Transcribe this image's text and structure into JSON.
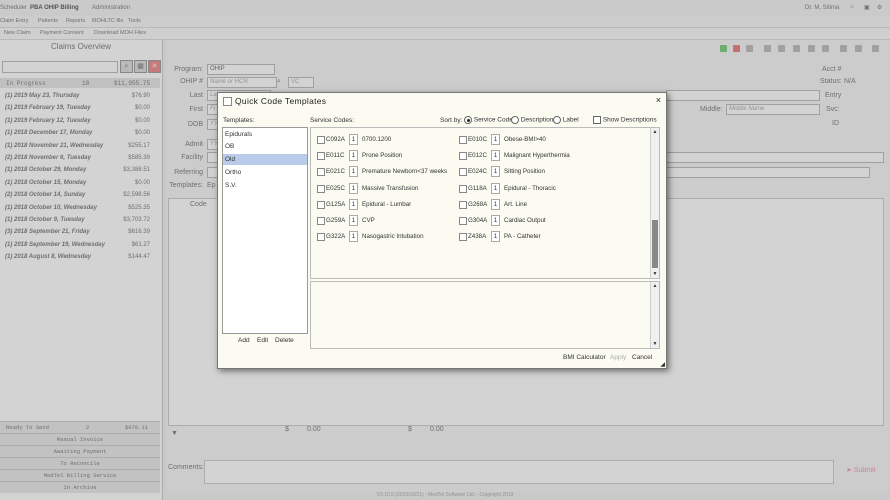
{
  "topbar": {
    "tabs": [
      "Scheduler",
      "PBA OHIP Billing",
      "Administration"
    ],
    "user": "Dr. M, Sitima"
  },
  "menubar": {
    "items": [
      "Claim Entry",
      "Patients",
      "Reports",
      "MOHLTC file",
      "Tools"
    ]
  },
  "subbar": {
    "items": [
      "New Claim",
      "Payment Consent",
      "Download MOH Files"
    ]
  },
  "left_panel": {
    "title": "Claims Overview",
    "in_progress": {
      "label": "In Progress",
      "count": "18",
      "amount": "$11,955.75"
    },
    "claims": [
      {
        "date": "(1) 2019 May 23, Thursday",
        "amount": "$76.90"
      },
      {
        "date": "(1) 2019 February 19, Tuesday",
        "amount": "$0.00"
      },
      {
        "date": "(1) 2019 February 12, Tuesday",
        "amount": "$0.00"
      },
      {
        "date": "(1) 2018 December 17, Monday",
        "amount": "$0.00"
      },
      {
        "date": "(1) 2018 November 21, Wednesday",
        "amount": "$255.17"
      },
      {
        "date": "(2) 2018 November 6, Tuesday",
        "amount": "$585.39"
      },
      {
        "date": "(1) 2018 October 29, Monday",
        "amount": "$3,388.51"
      },
      {
        "date": "(1) 2018 October 15, Monday",
        "amount": "$0.00"
      },
      {
        "date": "(2) 2018 October 14, Sunday",
        "amount": "$2,598.56"
      },
      {
        "date": "(1) 2018 October 10, Wednesday",
        "amount": "$525.35"
      },
      {
        "date": "(1) 2018 October 9, Tuesday",
        "amount": "$3,703.72"
      },
      {
        "date": "(3) 2018 September 21, Friday",
        "amount": "$616.39"
      },
      {
        "date": "(1) 2018 September 19, Wednesday",
        "amount": "$61.27"
      },
      {
        "date": "(1) 2018 August 8, Wednesday",
        "amount": "$144.47"
      }
    ],
    "ready_to_send": {
      "label": "Ready To Send",
      "count": "2",
      "amount": "$970.11"
    },
    "footer_items": [
      "Manual Invoice",
      "Awaiting Payment",
      "To Reconcile",
      "MedTel Billing Service",
      "In Archive"
    ]
  },
  "form": {
    "program_label": "Program:",
    "program_value": "OHIP",
    "ohip_label": "OHIP #",
    "ohip_placeholder": "Name or HCN",
    "vc_placeholder": "VC",
    "last_label": "Last",
    "last_value": "La",
    "first_label": "First",
    "first_value": "Fi",
    "dob_label": "DOB",
    "dob_value": "YY",
    "admit_label": "Admit",
    "admit_value": "YY",
    "facility_label": "Facility",
    "referring_label": "Referring",
    "templates_label": "Templates:",
    "templates_value": "Ep",
    "middle_label": "Middle:",
    "middle_placeholder": "Middle Name",
    "acct_label": "Acct #",
    "status_label": "Status:",
    "status_value": "N/A",
    "entry_label": "Entry",
    "svc_label": "Svc:",
    "id_label": "ID",
    "grid_code_header": "Code",
    "total1": "$",
    "total1_value": "0.00",
    "total2": "$",
    "total2_value": "0.00",
    "comments_label": "Comments:",
    "submit_label": "Submit",
    "footer_text": "V3.10.5 (2019/10/21) - MedTel Software Ltd. - Copyright 2019"
  },
  "dialog": {
    "title": "Quick Code Templates",
    "templates_label": "Templates:",
    "templates": [
      "Epidurals",
      "OB",
      "Old",
      "Ortho",
      "S.V."
    ],
    "selected_template": "Old",
    "service_codes_label": "Service Codes:",
    "sort_by_label": "Sort by:",
    "sort_options": [
      "Service Code",
      "Description",
      "Label"
    ],
    "sort_selected": "Service Code",
    "show_descriptions_label": "Show Descriptions",
    "codes_left": [
      {
        "code": "C092A",
        "qty": "1",
        "desc": "0700.1200"
      },
      {
        "code": "E011C",
        "qty": "1",
        "desc": "Prone Position"
      },
      {
        "code": "E021C",
        "qty": "1",
        "desc": "Premature Newborn<37 weeks"
      },
      {
        "code": "E025C",
        "qty": "1",
        "desc": "Massive Transfusion"
      },
      {
        "code": "G125A",
        "qty": "1",
        "desc": "Epidural - Lumbar"
      },
      {
        "code": "G259A",
        "qty": "1",
        "desc": "CVP"
      },
      {
        "code": "G322A",
        "qty": "1",
        "desc": "Nasogastric Intubation"
      }
    ],
    "codes_right": [
      {
        "code": "E010C",
        "qty": "1",
        "desc": "Obese-BMI>40"
      },
      {
        "code": "E012C",
        "qty": "1",
        "desc": "Malignant Hyperthermia"
      },
      {
        "code": "E024C",
        "qty": "1",
        "desc": "Sitting Position"
      },
      {
        "code": "G118A",
        "qty": "1",
        "desc": "Epidural - Thoracic"
      },
      {
        "code": "G268A",
        "qty": "1",
        "desc": "Art. Line"
      },
      {
        "code": "G304A",
        "qty": "1",
        "desc": "Cardiac Output"
      },
      {
        "code": "Z438A",
        "qty": "1",
        "desc": "PA - Catheter"
      }
    ],
    "add_label": "Add",
    "edit_label": "Edit",
    "delete_label": "Delete",
    "bmi_label": "BMI Calculator",
    "apply_label": "Apply",
    "cancel_label": "Cancel"
  }
}
